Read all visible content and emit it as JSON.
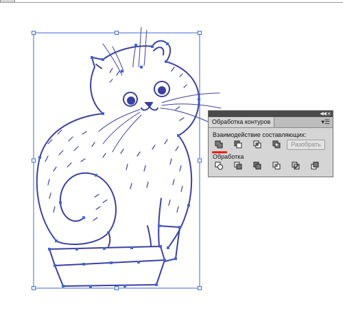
{
  "panel": {
    "title": "Обработка контуров",
    "shape_modes_label": "Взаимодействие составляющих:",
    "expand_label": "Разобрать",
    "pathfinders_label": "Обработка"
  },
  "colors": {
    "selection": "#3f68d8",
    "artwork": "#3a3fa0",
    "panel_bg": "#d5d5d5",
    "panel_header": "#4a4a4a",
    "highlight_underline": "#e8201a"
  },
  "icons": {
    "shape_modes": [
      "unite-icon",
      "minus-front-icon",
      "intersect-icon",
      "exclude-icon"
    ],
    "pathfinders": [
      "divide-icon",
      "trim-icon",
      "merge-icon",
      "crop-icon",
      "outline-icon",
      "minus-back-icon"
    ]
  }
}
